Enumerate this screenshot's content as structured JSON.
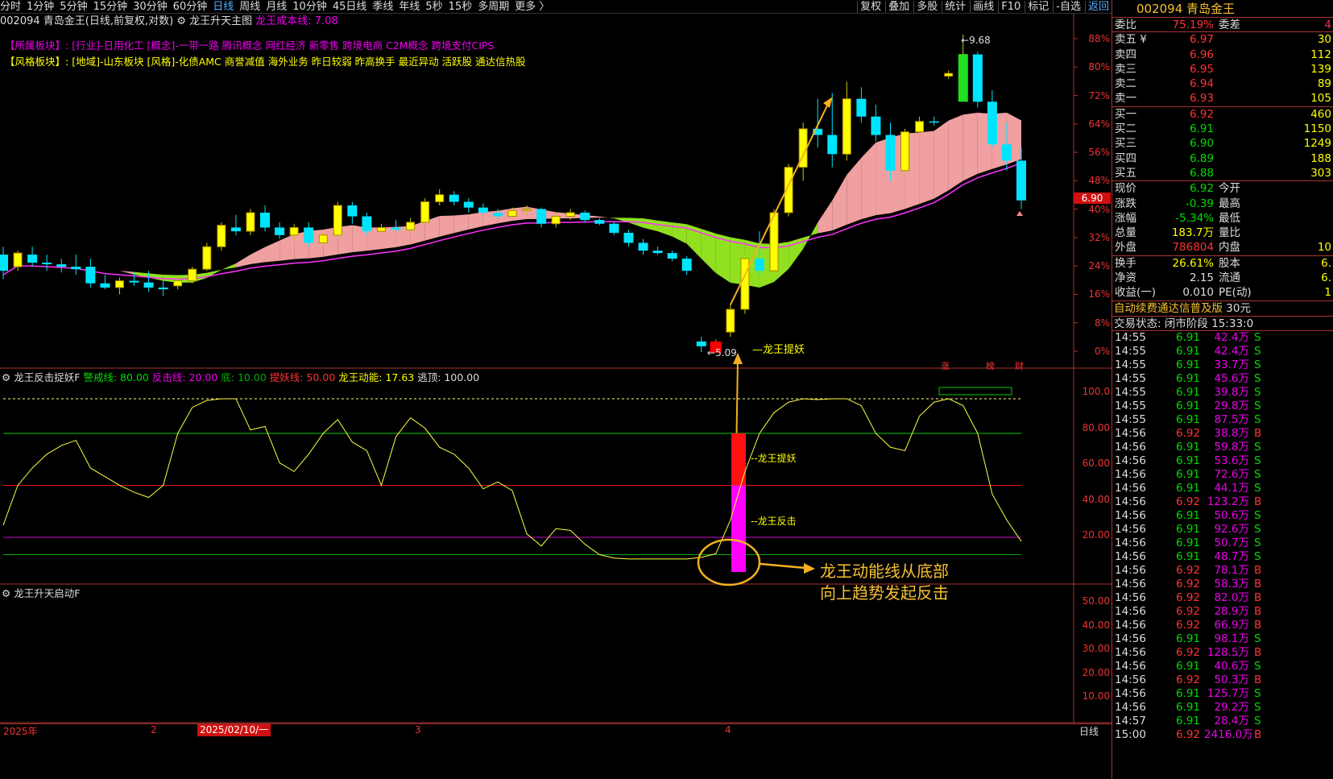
{
  "topbar": {
    "periods": [
      "分时",
      "1分钟",
      "5分钟",
      "15分钟",
      "30分钟",
      "60分钟",
      "日线",
      "周线",
      "月线",
      "10分钟",
      "45日线",
      "季线",
      "年线",
      "5秒",
      "15秒",
      "多周期",
      "更多 〉"
    ],
    "active_period": "日线",
    "tools": [
      "复权",
      "叠加",
      "多股",
      "统计",
      "画线",
      "F10",
      "标记",
      "-自选",
      "返回"
    ]
  },
  "title": {
    "stock": "002094 青岛金王(日线,前复权,对数)",
    "indicator": "龙王升天主图",
    "cost_line": "龙王成本线: 7.08"
  },
  "sectors": {
    "line1_label": "【所属板块】:",
    "line1": "[行业]-日用化工 [概念]-一带一路 腾讯概念 网红经济 新零售 跨境电商 C2M概念 跨境支付CIPS",
    "line2_label": "【风格板块】:",
    "line2": "[地域]-山东板块 [风格]-化债AMC 商誉减值 海外业务 昨日较弱 昨高换手 最近异动 活跃股 通达信热股"
  },
  "main_axis": [
    "88%",
    "80%",
    "72%",
    "64%",
    "56%",
    "48%",
    "40%",
    "32%",
    "24%",
    "16%",
    "8%",
    "0%"
  ],
  "price_tag": "6.90",
  "annotations": {
    "high": "9.68",
    "low": "5.09",
    "signal": "龙王提妖",
    "sub_tiyao": "龙王提妖",
    "sub_fanji": "龙王反击",
    "callout_line1": "龙王动能线从底部",
    "callout_line2": "向上趋势发起反击"
  },
  "marks": {
    "zhang": "涨",
    "bang": "榜",
    "cai": "财"
  },
  "sub1": {
    "name": "龙王反击捉妖F",
    "warn": "警戒线: 80.00",
    "fanji": "反击线: 20.00",
    "di": "底: 10.00",
    "tiyao": "提妖线: 50.00",
    "dongneng": "龙王动能: 17.63",
    "taoding": "逃顶: 100.00",
    "axis": [
      "100.0",
      "80.00",
      "60.00",
      "40.00",
      "20.00"
    ]
  },
  "sub2": {
    "name": "龙王升天启动F",
    "axis": [
      "50.00",
      "40.00",
      "30.00",
      "20.00",
      "10.00"
    ]
  },
  "bottom": {
    "year": "2025年",
    "m2": "2",
    "date": "2025/02/10/一",
    "m3": "3",
    "m4": "4",
    "period": "日线"
  },
  "chart_data": {
    "type": "candlestick",
    "ohlc": [
      [
        6.2,
        6.3,
        5.9,
        6.0
      ],
      [
        6.05,
        6.25,
        6.0,
        6.22
      ],
      [
        6.2,
        6.3,
        6.05,
        6.1
      ],
      [
        6.1,
        6.2,
        6.0,
        6.08
      ],
      [
        6.08,
        6.15,
        5.98,
        6.05
      ],
      [
        6.05,
        6.2,
        5.95,
        6.02
      ],
      [
        6.05,
        6.15,
        5.8,
        5.85
      ],
      [
        5.85,
        5.95,
        5.78,
        5.8
      ],
      [
        5.8,
        5.92,
        5.72,
        5.88
      ],
      [
        5.88,
        5.98,
        5.82,
        5.86
      ],
      [
        5.86,
        6.0,
        5.75,
        5.8
      ],
      [
        5.8,
        5.88,
        5.7,
        5.78
      ],
      [
        5.82,
        5.95,
        5.78,
        5.88
      ],
      [
        5.88,
        6.05,
        5.85,
        6.02
      ],
      [
        6.02,
        6.35,
        6.0,
        6.3
      ],
      [
        6.3,
        6.62,
        6.25,
        6.58
      ],
      [
        6.55,
        6.72,
        6.45,
        6.5
      ],
      [
        6.5,
        6.8,
        6.45,
        6.75
      ],
      [
        6.75,
        6.85,
        6.5,
        6.55
      ],
      [
        6.55,
        6.62,
        6.4,
        6.45
      ],
      [
        6.45,
        6.6,
        6.38,
        6.55
      ],
      [
        6.55,
        6.62,
        6.3,
        6.35
      ],
      [
        6.35,
        6.5,
        6.3,
        6.45
      ],
      [
        6.45,
        6.9,
        6.42,
        6.85
      ],
      [
        6.85,
        6.9,
        6.6,
        6.7
      ],
      [
        6.7,
        6.75,
        6.45,
        6.5
      ],
      [
        6.5,
        6.6,
        6.45,
        6.55
      ],
      [
        6.55,
        6.65,
        6.48,
        6.52
      ],
      [
        6.52,
        6.68,
        6.48,
        6.62
      ],
      [
        6.62,
        6.95,
        6.58,
        6.9
      ],
      [
        6.9,
        7.08,
        6.85,
        7.0
      ],
      [
        7.0,
        7.05,
        6.85,
        6.9
      ],
      [
        6.9,
        6.95,
        6.75,
        6.82
      ],
      [
        6.82,
        6.88,
        6.72,
        6.75
      ],
      [
        6.75,
        6.8,
        6.65,
        6.7
      ],
      [
        6.7,
        6.82,
        6.68,
        6.78
      ],
      [
        6.78,
        6.85,
        6.72,
        6.8
      ],
      [
        6.8,
        6.82,
        6.55,
        6.6
      ],
      [
        6.6,
        6.75,
        6.55,
        6.7
      ],
      [
        6.7,
        6.8,
        6.65,
        6.75
      ],
      [
        6.75,
        6.78,
        6.62,
        6.65
      ],
      [
        6.65,
        6.68,
        6.58,
        6.6
      ],
      [
        6.6,
        6.62,
        6.45,
        6.48
      ],
      [
        6.48,
        6.52,
        6.3,
        6.35
      ],
      [
        6.35,
        6.4,
        6.2,
        6.25
      ],
      [
        6.25,
        6.3,
        6.2,
        6.22
      ],
      [
        6.22,
        6.25,
        6.12,
        6.15
      ],
      [
        6.15,
        6.18,
        5.95,
        6.0
      ],
      [
        5.2,
        5.25,
        5.09,
        5.15
      ],
      [
        5.15,
        5.22,
        5.1,
        5.18
      ],
      [
        5.3,
        5.6,
        5.25,
        5.55
      ],
      [
        5.55,
        6.2,
        5.5,
        6.15
      ],
      [
        6.15,
        6.5,
        5.95,
        6.0
      ],
      [
        6.0,
        6.8,
        5.95,
        6.75
      ],
      [
        6.75,
        7.45,
        6.7,
        7.4
      ],
      [
        7.4,
        8.1,
        7.2,
        8.0
      ],
      [
        8.0,
        8.5,
        7.7,
        7.9
      ],
      [
        7.9,
        8.6,
        7.4,
        7.6
      ],
      [
        7.6,
        8.8,
        7.5,
        8.5
      ],
      [
        8.5,
        8.7,
        8.1,
        8.2
      ],
      [
        8.2,
        8.4,
        7.8,
        7.9
      ],
      [
        7.9,
        8.1,
        7.2,
        7.35
      ],
      [
        7.35,
        8.0,
        7.3,
        7.95
      ],
      [
        7.95,
        8.2,
        7.9,
        8.12
      ],
      [
        8.12,
        8.2,
        8.05,
        8.1
      ],
      [
        8.9,
        9.0,
        8.85,
        8.95
      ],
      [
        8.95,
        9.68,
        8.85,
        9.3
      ],
      [
        9.3,
        9.35,
        8.35,
        8.45
      ],
      [
        8.45,
        8.65,
        7.7,
        7.75
      ],
      [
        7.75,
        8.1,
        7.35,
        7.5
      ],
      [
        7.5,
        7.7,
        6.8,
        6.92
      ]
    ],
    "yaxis_pct": [
      0,
      8,
      16,
      24,
      32,
      40,
      48,
      56,
      64,
      72,
      80,
      88
    ],
    "high": 9.68,
    "low": 5.09,
    "last": 6.92,
    "indicator_line": [
      27,
      50,
      60,
      68,
      73,
      76,
      60,
      55,
      50,
      46,
      43,
      50,
      80,
      95,
      99,
      100,
      100,
      82,
      84,
      63,
      58,
      68,
      80,
      88,
      75,
      70,
      50,
      78,
      89,
      83,
      72,
      68,
      60,
      48,
      52,
      47,
      22,
      15,
      25,
      24,
      16,
      10,
      8,
      7.5,
      7.5,
      7.5,
      7.5,
      7.5,
      8.5,
      10.5,
      30,
      58,
      80,
      92,
      98,
      100,
      99.5,
      100,
      100,
      96,
      80,
      72,
      70,
      90,
      98,
      100,
      96,
      80,
      45,
      30,
      17.63
    ],
    "indicator_levels": {
      "warn": 80,
      "tiyao": 50,
      "fanji": 20,
      "di": 10,
      "taoding": 100
    }
  },
  "quote": {
    "code_name": "002094 青岛金王",
    "weibi_label": "委比",
    "weibi": "75.19%",
    "weicha_label": "委差",
    "weicha": "4",
    "asks": [
      {
        "label": "卖五 ¥",
        "price": "6.97",
        "vol": "30"
      },
      {
        "label": "卖四",
        "price": "6.96",
        "vol": "112"
      },
      {
        "label": "卖三",
        "price": "6.95",
        "vol": "139"
      },
      {
        "label": "卖二",
        "price": "6.94",
        "vol": "89"
      },
      {
        "label": "卖一",
        "price": "6.93",
        "vol": "105"
      }
    ],
    "bids": [
      {
        "label": "买一",
        "price": "6.92",
        "vol": "460"
      },
      {
        "label": "买二",
        "price": "6.91",
        "vol": "1150"
      },
      {
        "label": "买三",
        "price": "6.90",
        "vol": "1249"
      },
      {
        "label": "买四",
        "price": "6.89",
        "vol": "188"
      },
      {
        "label": "买五",
        "price": "6.88",
        "vol": "303"
      }
    ],
    "stats": [
      {
        "l": "现价",
        "v": "6.92",
        "vc": "green",
        "l2": "今开",
        "v2": ""
      },
      {
        "l": "涨跌",
        "v": "-0.39",
        "vc": "green",
        "l2": "最高",
        "v2": ""
      },
      {
        "l": "涨幅",
        "v": "-5.34%",
        "vc": "green",
        "l2": "最低",
        "v2": ""
      },
      {
        "l": "总量",
        "v": "183.7万",
        "vc": "yel",
        "l2": "量比",
        "v2": ""
      },
      {
        "l": "外盘",
        "v": "786804",
        "vc": "red",
        "l2": "内盘",
        "v2": "10"
      }
    ],
    "stats2": [
      {
        "l": "换手",
        "v": "26.61%",
        "vc": "yel",
        "l2": "股本",
        "v2": "6."
      },
      {
        "l": "净资",
        "v": "2.15",
        "vc": "wht",
        "l2": "流通",
        "v2": "6."
      },
      {
        "l": "收益(一)",
        "v": "0.010",
        "vc": "wht",
        "l2": "PE(动)",
        "v2": "1"
      }
    ],
    "ad": "自动续费通达信普及版",
    "ad_right": "30元",
    "trade_state": "交易状态: 闭市阶段 15:33:0"
  },
  "ticks": [
    {
      "t": "14:55",
      "p": "6.91",
      "v": "42.4万",
      "d": "S"
    },
    {
      "t": "14:55",
      "p": "6.91",
      "v": "42.4万",
      "d": "S"
    },
    {
      "t": "14:55",
      "p": "6.91",
      "v": "33.7万",
      "d": "S"
    },
    {
      "t": "14:55",
      "p": "6.91",
      "v": "45.6万",
      "d": "S"
    },
    {
      "t": "14:55",
      "p": "6.91",
      "v": "39.8万",
      "d": "S"
    },
    {
      "t": "14:55",
      "p": "6.91",
      "v": "29.8万",
      "d": "S"
    },
    {
      "t": "14:55",
      "p": "6.91",
      "v": "87.5万",
      "d": "S"
    },
    {
      "t": "14:56",
      "p": "6.92",
      "v": "38.8万",
      "d": "B"
    },
    {
      "t": "14:56",
      "p": "6.91",
      "v": "59.8万",
      "d": "S"
    },
    {
      "t": "14:56",
      "p": "6.91",
      "v": "53.6万",
      "d": "S"
    },
    {
      "t": "14:56",
      "p": "6.91",
      "v": "72.6万",
      "d": "S"
    },
    {
      "t": "14:56",
      "p": "6.91",
      "v": "44.1万",
      "d": "S"
    },
    {
      "t": "14:56",
      "p": "6.92",
      "v": "123.2万",
      "d": "B"
    },
    {
      "t": "14:56",
      "p": "6.91",
      "v": "50.6万",
      "d": "S"
    },
    {
      "t": "14:56",
      "p": "6.91",
      "v": "92.6万",
      "d": "S"
    },
    {
      "t": "14:56",
      "p": "6.91",
      "v": "50.7万",
      "d": "S"
    },
    {
      "t": "14:56",
      "p": "6.91",
      "v": "48.7万",
      "d": "S"
    },
    {
      "t": "14:56",
      "p": "6.92",
      "v": "78.1万",
      "d": "B"
    },
    {
      "t": "14:56",
      "p": "6.92",
      "v": "58.3万",
      "d": "B"
    },
    {
      "t": "14:56",
      "p": "6.92",
      "v": "82.0万",
      "d": "B"
    },
    {
      "t": "14:56",
      "p": "6.92",
      "v": "28.9万",
      "d": "B"
    },
    {
      "t": "14:56",
      "p": "6.92",
      "v": "66.9万",
      "d": "B"
    },
    {
      "t": "14:56",
      "p": "6.91",
      "v": "98.1万",
      "d": "S"
    },
    {
      "t": "14:56",
      "p": "6.92",
      "v": "128.5万",
      "d": "B"
    },
    {
      "t": "14:56",
      "p": "6.91",
      "v": "40.6万",
      "d": "S"
    },
    {
      "t": "14:56",
      "p": "6.92",
      "v": "50.3万",
      "d": "B"
    },
    {
      "t": "14:56",
      "p": "6.91",
      "v": "125.7万",
      "d": "S"
    },
    {
      "t": "14:56",
      "p": "6.91",
      "v": "29.2万",
      "d": "S"
    },
    {
      "t": "14:57",
      "p": "6.91",
      "v": "28.4万",
      "d": "S"
    },
    {
      "t": "15:00",
      "p": "6.92",
      "v": "2416.0万",
      "d": "B"
    }
  ],
  "colors": {
    "up": "#ffff00",
    "down": "#00e5ff",
    "ma": "#ff30ff",
    "line": "#ffff40"
  }
}
